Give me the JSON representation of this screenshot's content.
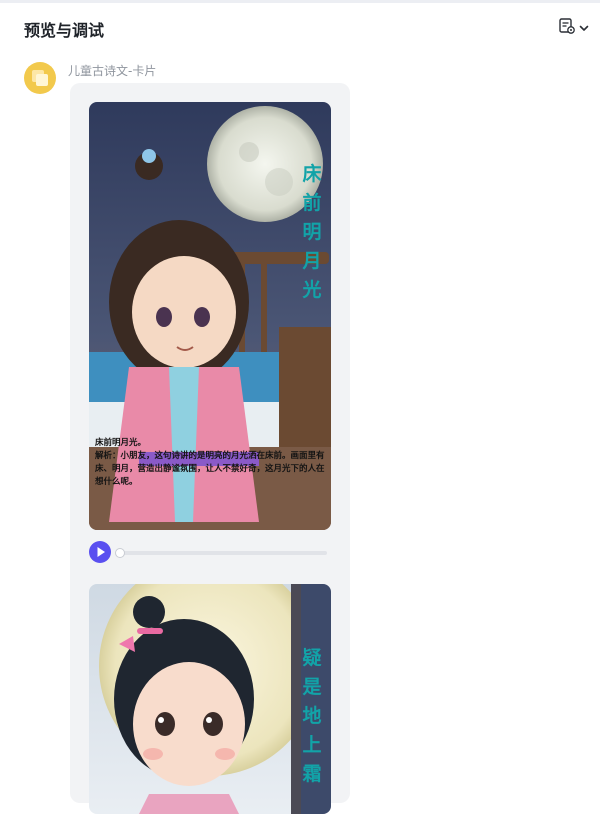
{
  "header": {
    "title": "预览与调试",
    "settings_icon": "form-settings-icon",
    "dropdown_icon": "chevron-down-icon"
  },
  "message": {
    "sender": "儿童古诗文-卡片",
    "avatar_icon": "bot-avatar-icon",
    "cards": [
      {
        "poem_line": "床前明月光",
        "caption": "床前明月光。\n解析：小朋友，这句诗讲的是明亮的月光洒在床前。画面里有床、明月，营造出静谧氛围，让人不禁好奇，这月光下的人在想什么呢。"
      },
      {
        "poem_line": "疑是地上霜"
      }
    ],
    "audio": {
      "play_icon": "play-icon",
      "progress": 0
    }
  },
  "colors": {
    "accent": "#5a4ff0",
    "poem_text": "#12a3a8",
    "bubble_bg": "#f2f3f5"
  }
}
